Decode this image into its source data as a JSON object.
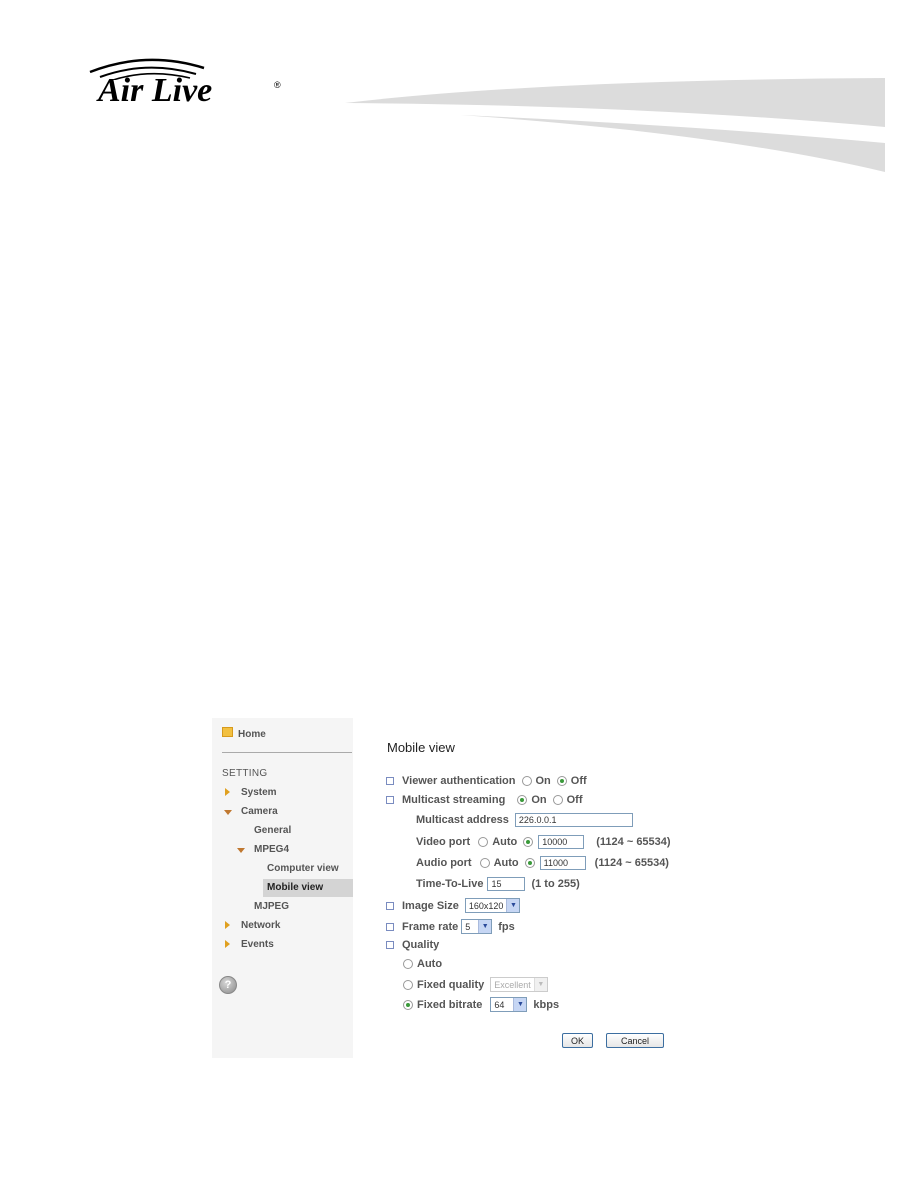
{
  "header": {
    "logo_text": "Air Live",
    "logo_registered": "®"
  },
  "sidebar": {
    "home": "Home",
    "section_heading": "SETTING",
    "items": [
      {
        "label": "System",
        "level": 1,
        "state": "collapsed"
      },
      {
        "label": "Camera",
        "level": 1,
        "state": "expanded"
      },
      {
        "label": "General",
        "level": 2
      },
      {
        "label": "MPEG4",
        "level": 2,
        "state": "expanded"
      },
      {
        "label": "Computer view",
        "level": 3
      },
      {
        "label": "Mobile view",
        "level": 3,
        "selected": true
      },
      {
        "label": "MJPEG",
        "level": 2
      },
      {
        "label": "Network",
        "level": 1,
        "state": "collapsed"
      },
      {
        "label": "Events",
        "level": 1,
        "state": "collapsed"
      }
    ],
    "help_icon": "help-icon"
  },
  "main": {
    "title": "Mobile view",
    "viewer_authentication": {
      "label": "Viewer authentication",
      "on": "On",
      "off": "Off",
      "selected": "Off"
    },
    "multicast_streaming": {
      "label": "Multicast streaming",
      "on": "On",
      "off": "Off",
      "selected": "On"
    },
    "multicast_address": {
      "label": "Multicast address",
      "value": "226.0.0.1"
    },
    "video_port": {
      "label": "Video port",
      "auto": "Auto",
      "value": "10000",
      "range": "(1124 ~ 65534)",
      "selected": "manual"
    },
    "audio_port": {
      "label": "Audio port",
      "auto": "Auto",
      "value": "11000",
      "range": "(1124 ~ 65534)",
      "selected": "manual"
    },
    "ttl": {
      "label": "Time-To-Live",
      "value": "15",
      "range": "(1 to 255)"
    },
    "image_size": {
      "label": "Image Size",
      "value": "160x120"
    },
    "frame_rate": {
      "label": "Frame rate",
      "value": "5",
      "unit": "fps"
    },
    "quality": {
      "label": "Quality",
      "auto": "Auto",
      "fixed_quality": {
        "label": "Fixed quality",
        "value": "Excellent"
      },
      "fixed_bitrate": {
        "label": "Fixed bitrate",
        "value": "64",
        "unit": "kbps"
      },
      "selected": "Fixed bitrate"
    },
    "buttons": {
      "ok": "OK",
      "cancel": "Cancel"
    }
  }
}
